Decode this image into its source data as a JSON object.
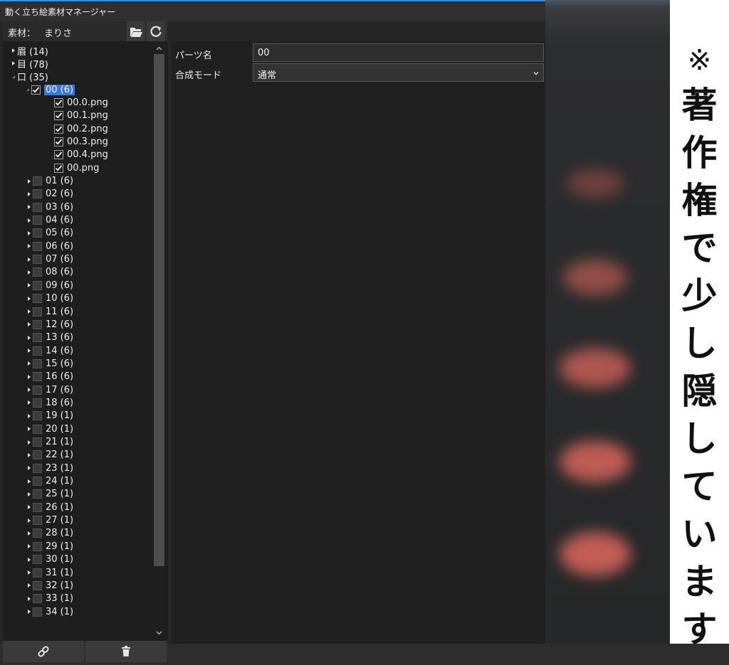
{
  "window": {
    "title": "動く立ち絵素材マネージャー"
  },
  "source_bar": {
    "label": "素材：",
    "value": "まりさ",
    "open_folder_icon": "folder-open-icon",
    "reload_icon": "refresh-icon"
  },
  "tree": {
    "groups": [
      {
        "label": "眉 (14)",
        "expanded": false
      },
      {
        "label": "目 (78)",
        "expanded": false
      },
      {
        "label": "口 (35)",
        "expanded": true
      }
    ],
    "selected_part": {
      "label": "00 (6)",
      "checked": true
    },
    "files": [
      "00.0.png",
      "00.1.png",
      "00.2.png",
      "00.3.png",
      "00.4.png",
      "00.png"
    ],
    "parts": [
      "01 (6)",
      "02 (6)",
      "03 (6)",
      "04 (6)",
      "05 (6)",
      "06 (6)",
      "07 (6)",
      "08 (6)",
      "09 (6)",
      "10 (6)",
      "11 (6)",
      "12 (6)",
      "13 (6)",
      "14 (6)",
      "15 (6)",
      "16 (6)",
      "17 (6)",
      "18 (6)",
      "19 (1)",
      "20 (1)",
      "21 (1)",
      "22 (1)",
      "23 (1)",
      "24 (1)",
      "25 (1)",
      "26 (1)",
      "27 (1)",
      "28 (1)",
      "29 (1)",
      "30 (1)",
      "31 (1)",
      "32 (1)",
      "33 (1)",
      "34 (1)"
    ]
  },
  "bottom_bar": {
    "link_icon": "link-icon",
    "delete_icon": "trash-icon"
  },
  "properties": {
    "part_name_label": "パーツ名",
    "part_name_value": "00",
    "blend_mode_label": "合成モード",
    "blend_mode_value": "通常"
  },
  "note": {
    "chars": [
      "※",
      "著",
      "作",
      "権",
      "で",
      "少",
      "し",
      "隠",
      "し",
      "て",
      "い",
      "ま",
      "す"
    ]
  },
  "colors": {
    "accent": "#3a7ad5",
    "title_border": "#3d8fd8",
    "blur_blob": "#e06a5e"
  }
}
